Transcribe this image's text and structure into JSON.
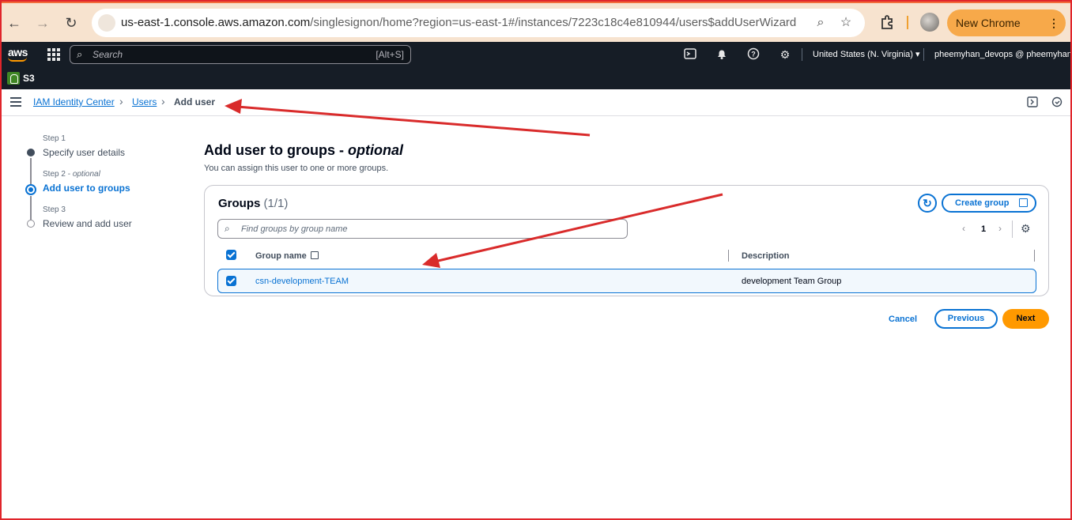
{
  "browser": {
    "url_host": "us-east-1.console.aws.amazon.com",
    "url_path": "/singlesignon/home?region=us-east-1#/instances/7223c18c4e810944/users$addUserWizard",
    "new_chrome_label": "New Chrome available",
    "icons": [
      "back-icon",
      "forward-icon",
      "reload-icon",
      "site-settings-icon",
      "zoom-icon",
      "bookmark-star-icon",
      "extensions-icon",
      "profile-avatar",
      "more-menu-icon"
    ]
  },
  "aws_nav": {
    "logo": "aws",
    "search_placeholder": "Search",
    "search_shortcut": "[Alt+S]",
    "region": "United States (N. Virginia) ▾",
    "account": "pheemyhan_devops @ pheemyhan ▾",
    "service_shortcut": "S3"
  },
  "breadcrumb": {
    "items": [
      "IAM Identity Center",
      "Users",
      "Add user"
    ]
  },
  "steps": [
    {
      "label": "Step 1",
      "title": "Specify user details"
    },
    {
      "label": "Step 2",
      "label_suffix": "optional",
      "title": "Add user to groups"
    },
    {
      "label": "Step 3",
      "title": "Review and add user"
    }
  ],
  "page": {
    "title": "Add user to groups - ",
    "title_suffix": "optional",
    "subtitle": "You can assign this user to one or more groups."
  },
  "groups": {
    "title": "Groups",
    "count": "(1/1)",
    "create_label": "Create group",
    "search_placeholder": "Find groups by group name",
    "page": "1",
    "columns": [
      "Group name",
      "Description"
    ],
    "rows": [
      {
        "name": "csn-development-TEAM",
        "description": "development Team Group",
        "selected": true
      }
    ]
  },
  "actions": {
    "cancel": "Cancel",
    "previous": "Previous",
    "next": "Next"
  },
  "colors": {
    "accent": "#0972d3",
    "primary_button": "#ff9900",
    "annotation_arrow": "#d92b2b"
  }
}
